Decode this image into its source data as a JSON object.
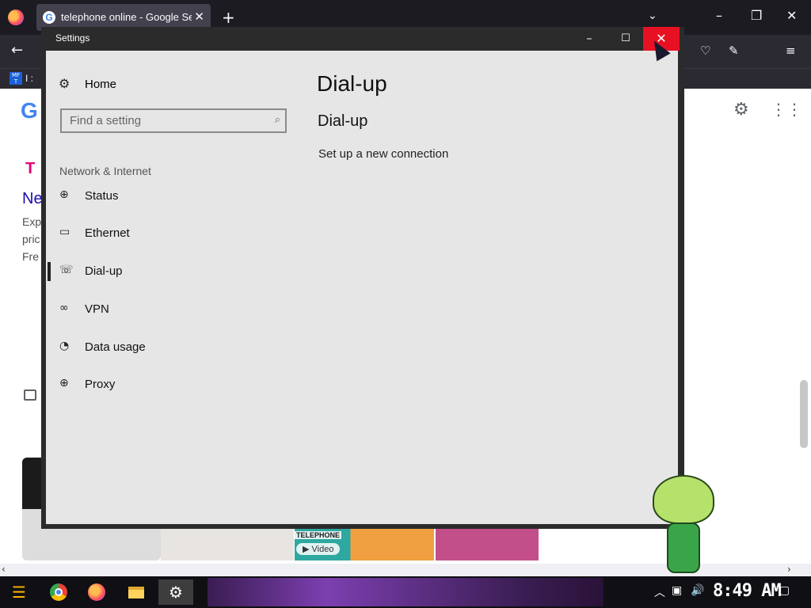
{
  "browser": {
    "tab_title": "telephone online - Google Sea",
    "tab_favicon": "G",
    "tab_close": "✕",
    "new_tab": "+",
    "tab_list": "⌄",
    "win_min": "–",
    "win_restore": "❐",
    "win_close": "✕",
    "back": "←",
    "bookmark_icon": "MF T",
    "bookmark_label": "I :",
    "icons": [
      "back-icon",
      "pocket-icon",
      "extensions-icon",
      "menu-icon"
    ]
  },
  "page": {
    "google_letter": "G",
    "ad_brand": "T",
    "ad_title": "Ne",
    "ad_lines": [
      "Exp",
      "pric",
      "Fre"
    ],
    "thumb_title": "TELEPHONE",
    "video_chip": "▶ Video",
    "hscroll_left": "‹",
    "hscroll_right": "›"
  },
  "settings": {
    "window_title": "Settings",
    "min": "–",
    "max": "☐",
    "close": "✕",
    "home_icon": "⚙",
    "home_label": "Home",
    "search_placeholder": "Find a setting",
    "search_icon": "⌕",
    "section_label": "Network & Internet",
    "nav_items": [
      {
        "label": "Status",
        "icon": "globe-status-icon",
        "glyph": "⊕"
      },
      {
        "label": "Ethernet",
        "icon": "ethernet-icon",
        "glyph": "▭"
      },
      {
        "label": "Dial-up",
        "icon": "dialup-icon",
        "glyph": "☏",
        "selected": true
      },
      {
        "label": "VPN",
        "icon": "vpn-icon",
        "glyph": "∞"
      },
      {
        "label": "Data usage",
        "icon": "data-usage-icon",
        "glyph": "◔"
      },
      {
        "label": "Proxy",
        "icon": "globe-icon",
        "glyph": "⊕"
      }
    ],
    "content": {
      "title": "Dial-up",
      "subtitle": "Dial-up",
      "link": "Set up a new connection"
    }
  },
  "taskbar": {
    "start_glyph": "☰",
    "settings_glyph": "⚙",
    "tray_chevron": "︿",
    "tray_network": "▣",
    "tray_volume": "🔊",
    "clock": "8:49 AM",
    "notifications": "▢"
  },
  "colors": {
    "close_red": "#e81123",
    "settings_bg": "#e6e6e6",
    "taskbar_purple": "#7c3fb0"
  }
}
